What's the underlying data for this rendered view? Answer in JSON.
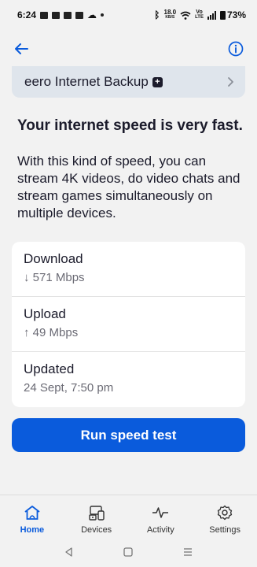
{
  "status_bar": {
    "time": "6:24",
    "speed_value": "18.0",
    "speed_unit": "KB/S",
    "volte_top": "Vo",
    "volte_bottom": "LTE",
    "battery": "73%"
  },
  "header": {
    "back_icon": "arrow-left-icon",
    "info_icon": "info-icon"
  },
  "backup": {
    "title": "eero Internet Backup",
    "badge": "+"
  },
  "result": {
    "headline": "Your internet speed is very fast.",
    "description": "With this kind of speed, you can stream 4K videos, do video chats and stream games simultaneously on multiple devices."
  },
  "stats": [
    {
      "label": "Download",
      "value": "↓ 571 Mbps"
    },
    {
      "label": "Upload",
      "value": "↑ 49 Mbps"
    },
    {
      "label": "Updated",
      "value": "24 Sept, 7:50 pm"
    }
  ],
  "run_button": "Run speed test",
  "tabs": [
    {
      "label": "Home",
      "icon": "home-icon",
      "active": true
    },
    {
      "label": "Devices",
      "icon": "devices-icon",
      "active": false
    },
    {
      "label": "Activity",
      "icon": "activity-icon",
      "active": false
    },
    {
      "label": "Settings",
      "icon": "gear-icon",
      "active": false
    }
  ],
  "colors": {
    "accent": "#0a5bdc",
    "background": "#f2f2f2",
    "backup_card": "#dfe5ec",
    "text": "#1b1b2b"
  }
}
